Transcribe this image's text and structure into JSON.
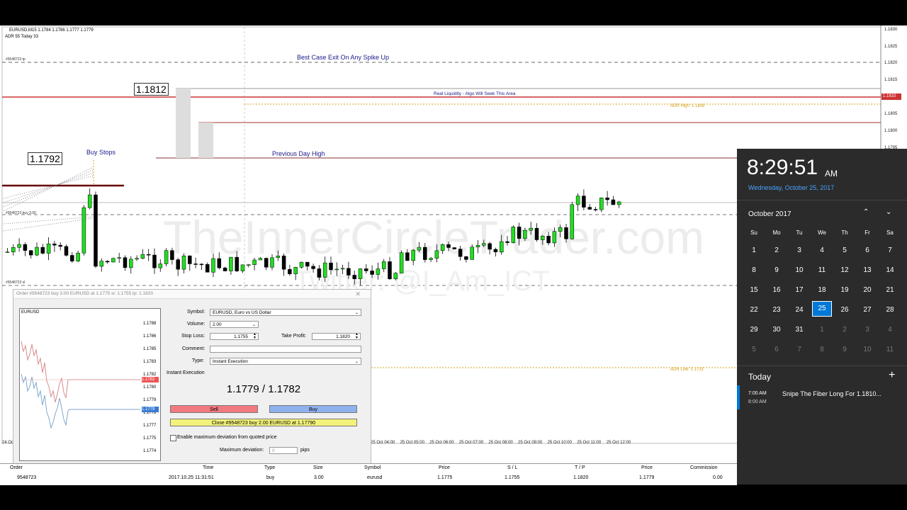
{
  "chart": {
    "header_line1": "EURUSD,M15  1.1784 1.1786 1.1777 1.1779",
    "header_line2": "ADR 55  Today 33",
    "watermark1": "TheInnerCircleTrader.com",
    "watermark2": "Twitter: @I_Am_ICT",
    "annotations": {
      "best_case": "Best Case Exit On Any Spike Up",
      "real_liquidity": "Real Liquidity - Algo Will Seek This Area",
      "adr_high": "ADR High: 1.1808",
      "adr_low": "ADR Low: 1.1731",
      "buy_stops": "Buy Stops",
      "prev_day_high": "Previous Day High",
      "order_tp": "#9548723 tp",
      "order_buy": "#9548723 buy 3.00",
      "order_sl": "#9548723 sl",
      "price_1812": "1.1812",
      "price_1792": "1.1792"
    },
    "y_axis": [
      "1.1830",
      "1.1825",
      "1.1820",
      "1.1815",
      "1.1810",
      "1.1805",
      "1.1800",
      "1.1795"
    ],
    "current_marker": "1.1810",
    "x_axis": [
      "25 Oct 04:00",
      "25 Oct 05:00",
      "25 Oct 06:00",
      "25 Oct 07:00",
      "25 Oct 08:00",
      "25 Oct 09:00",
      "25 Oct 10:00",
      "25 Oct 11:00",
      "25 Oct 12:00"
    ],
    "x_axis_left": "24 Oct"
  },
  "order_dialog": {
    "title": "Order #9548723 buy 3.00 EURUSD at 1.1775 sl: 1.1755 tp: 1.1820",
    "mini_chart": {
      "symbol": "EURUSD",
      "ticks": [
        "1.1788",
        "1.1786",
        "1.1785",
        "1.1783",
        "1.1782",
        "1.1780",
        "1.1779",
        "1.1778",
        "1.1777",
        "1.1775",
        "1.1774"
      ],
      "red_marker": "1.1782",
      "blue_marker": "1.1779"
    },
    "symbol_label": "Symbol:",
    "symbol_value": "EURUSD, Euro vs US Dollar",
    "volume_label": "Volume:",
    "volume_value": "2.00",
    "stop_loss_label": "Stop Loss:",
    "stop_loss_value": "1.1755",
    "take_profit_label": "Take Profit:",
    "take_profit_value": "1.1820",
    "comment_label": "Comment:",
    "comment_value": "",
    "type_label": "Type:",
    "type_value": "Instant Execution",
    "section_label": "Instant Execution",
    "quote": "1.1779 / 1.1782",
    "sell_label": "Sell",
    "buy_label": "Buy",
    "close_label": "Close #9548723 buy 2.00 EURUSD at 1.17790",
    "deviation_check_label": "Enable maximum deviation from quoted price",
    "max_dev_label": "Maximum deviation:",
    "max_dev_value": "0",
    "pips_label": "pips"
  },
  "terminal": {
    "headers": [
      "Order",
      "Time",
      "Type",
      "Size",
      "Symbol",
      "Price",
      "S / L",
      "T / P",
      "Price",
      "Commission"
    ],
    "row": [
      "9548723",
      "2017.10.25 11:31:51",
      "buy",
      "3.00",
      "eurusd",
      "1.1775",
      "1.1755",
      "1.1820",
      "1.1779",
      "0.00"
    ]
  },
  "clock": {
    "time": "8:29:51",
    "ampm": "AM",
    "date": "Wednesday, October 25, 2017",
    "month": "October 2017",
    "weekdays": [
      "Su",
      "Mo",
      "Tu",
      "We",
      "Th",
      "Fr",
      "Sa"
    ],
    "weeks": [
      [
        "1",
        "2",
        "3",
        "4",
        "5",
        "6",
        "7"
      ],
      [
        "8",
        "9",
        "10",
        "11",
        "12",
        "13",
        "14"
      ],
      [
        "15",
        "16",
        "17",
        "18",
        "19",
        "20",
        "21"
      ],
      [
        "22",
        "23",
        "24",
        "25",
        "26",
        "27",
        "28"
      ],
      [
        "29",
        "30",
        "31",
        "1",
        "2",
        "3",
        "4"
      ],
      [
        "5",
        "6",
        "7",
        "8",
        "9",
        "10",
        "11"
      ]
    ],
    "today_label": "Today",
    "event_start": "7:00 AM",
    "event_end": "8:00 AM",
    "event_title": "Snipe The Fiber Long For 1.1810...",
    "accent_color": "#0078d7"
  }
}
